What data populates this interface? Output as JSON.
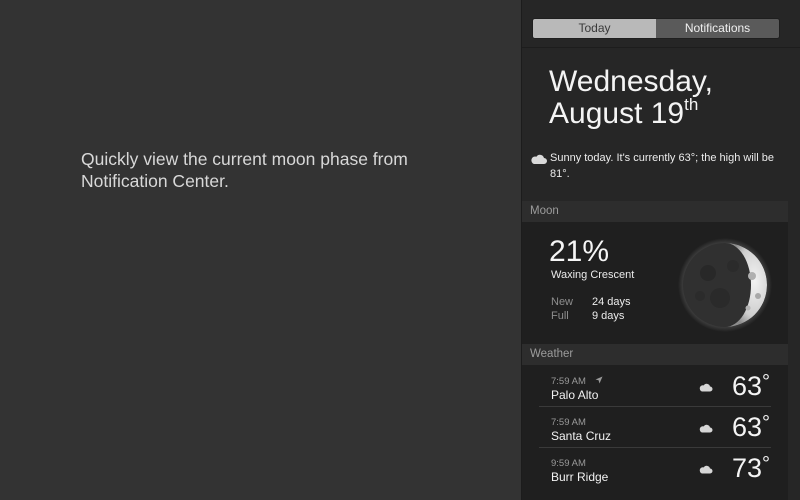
{
  "promo": {
    "text": "Quickly view the current moon phase from Notification Center."
  },
  "tabs": [
    {
      "label": "Today",
      "selected": true
    },
    {
      "label": "Notifications",
      "selected": false
    }
  ],
  "today": {
    "weekday": "Wednesday,",
    "month_day": "August 19",
    "ordinal": "th",
    "summary": "Sunny today. It's currently 63°; the high will be 81°.",
    "summary_icon": "cloud-icon"
  },
  "moon": {
    "header": "Moon",
    "percent": "21%",
    "phase": "Waxing Crescent",
    "new_label": "New",
    "new_value": "24 days",
    "full_label": "Full",
    "full_value": "9 days",
    "image": "moon-crescent"
  },
  "weather": {
    "header": "Weather",
    "locations": [
      {
        "time": "7:59 AM",
        "city": "Palo Alto",
        "temp": "63",
        "current_location": true,
        "icon": "cloud-icon"
      },
      {
        "time": "7:59 AM",
        "city": "Santa Cruz",
        "temp": "63",
        "current_location": false,
        "icon": "cloud-icon"
      },
      {
        "time": "9:59 AM",
        "city": "Burr Ridge",
        "temp": "73",
        "current_location": false,
        "icon": "cloud-icon"
      }
    ],
    "degree_symbol": "°"
  },
  "colors": {
    "background": "#333333",
    "panel": "#262626",
    "tab_selected": "#b9b9b9",
    "tab_unselected": "#5a5a5a"
  }
}
